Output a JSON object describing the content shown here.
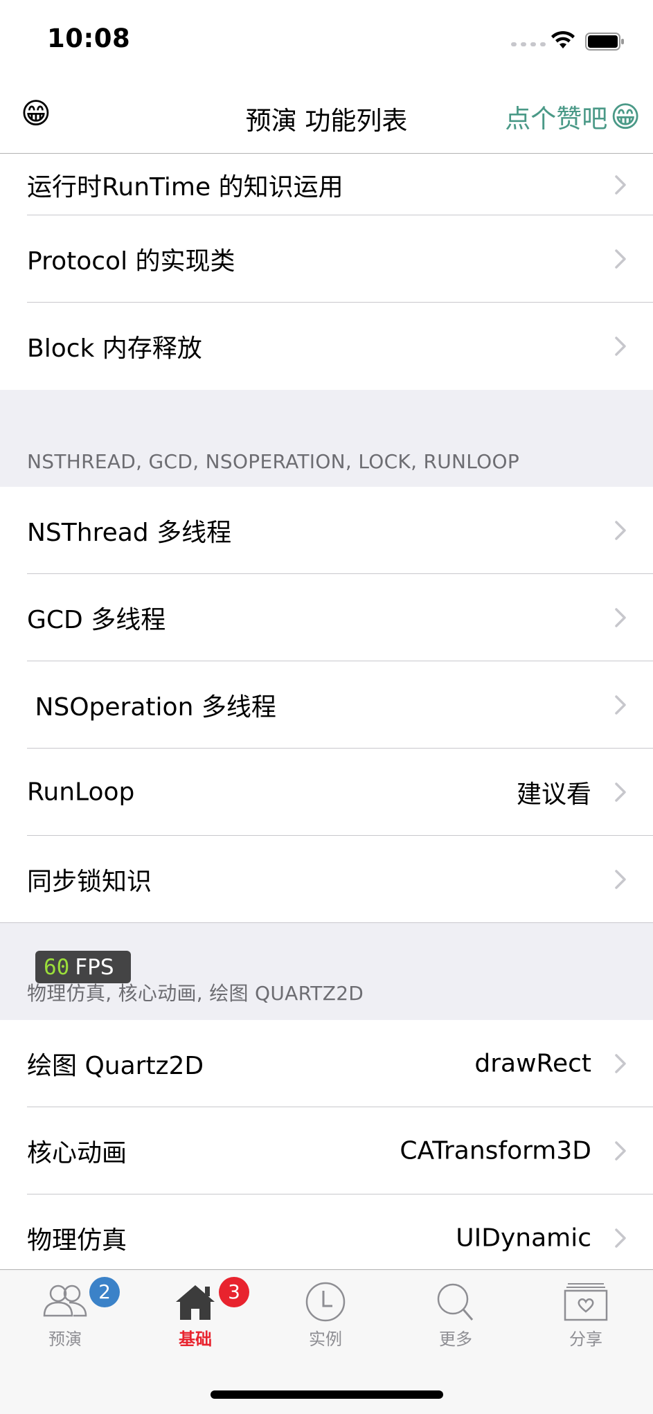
{
  "status_bar": {
    "time": "10:08"
  },
  "nav": {
    "left_emoji": "😁",
    "title": "预演 功能列表",
    "right_label": "点个赞吧",
    "right_emoji": "😁"
  },
  "table": {
    "rows_top": [
      {
        "label": "运行时RunTime 的知识运用",
        "detail": ""
      },
      {
        "label": "Protocol 的实现类",
        "detail": ""
      },
      {
        "label": "Block 内存释放",
        "detail": ""
      }
    ],
    "section2": {
      "header": "NSTHREAD, GCD, NSOPERATION, LOCK, RUNLOOP",
      "rows": [
        {
          "label": "NSThread 多线程",
          "detail": ""
        },
        {
          "label": "GCD 多线程",
          "detail": ""
        },
        {
          "label": " NSOperation 多线程",
          "detail": ""
        },
        {
          "label": "RunLoop",
          "detail": "建议看"
        },
        {
          "label": "同步锁知识",
          "detail": ""
        }
      ]
    },
    "section3": {
      "header": "物理仿真, 核心动画, 绘图 QUARTZ2D",
      "rows": [
        {
          "label": "绘图 Quartz2D",
          "detail": "drawRect"
        },
        {
          "label": "核心动画",
          "detail": "CATransform3D"
        },
        {
          "label": "物理仿真",
          "detail": "UIDynamic"
        }
      ]
    }
  },
  "fps": {
    "value": "60",
    "unit": "FPS"
  },
  "tab_bar": {
    "tabs": [
      {
        "label": "预演",
        "icon": "people-icon",
        "badge": "2",
        "badge_color": "#3b82c8"
      },
      {
        "label": "基础",
        "icon": "home-icon",
        "badge": "3",
        "badge_color": "#e8232e",
        "active": true
      },
      {
        "label": "实例",
        "icon": "clock-icon",
        "badge": ""
      },
      {
        "label": "更多",
        "icon": "search-icon",
        "badge": ""
      },
      {
        "label": "分享",
        "icon": "share-heart-icon",
        "badge": ""
      }
    ],
    "active_color": "#e8232e",
    "inactive_color": "#8e8e93"
  },
  "colors": {
    "accent_green": "#4a9987",
    "section_bg": "#efeff4"
  }
}
